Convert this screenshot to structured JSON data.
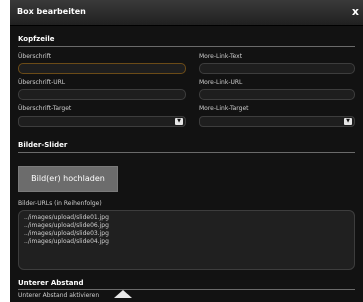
{
  "window": {
    "title": "Box bearbeiten",
    "close_label": "x"
  },
  "kopfzeile": {
    "title": "Kopfzeile",
    "left": [
      {
        "label": "Überschrift",
        "value": ""
      },
      {
        "label": "Überschrift-URL",
        "value": ""
      },
      {
        "label": "Überschrift-Target",
        "value": ""
      }
    ],
    "right": [
      {
        "label": "More-Link-Text",
        "value": ""
      },
      {
        "label": "More-Link-URL",
        "value": ""
      },
      {
        "label": "More-Link-Target",
        "value": ""
      }
    ]
  },
  "slider": {
    "title": "Bilder-Slider",
    "upload_button": "Bild(er) hochladen",
    "urls_label": "Bilder-URLs (in Reihenfolge)",
    "urls": [
      "../images/upload/slide01.jpg",
      "../images/upload/slide06.jpg",
      "../images/upload/slide03.jpg",
      "../images/upload/slide04.jpg"
    ]
  },
  "abstand": {
    "title": "Unterer Abstand",
    "label": "Unterer Abstand aktivieren"
  },
  "colors": {
    "dialog_bg": "#121212",
    "accent_border": "#6b4b17"
  },
  "icons": {
    "select_arrow": "chevron-down-icon",
    "close": "close-icon"
  }
}
